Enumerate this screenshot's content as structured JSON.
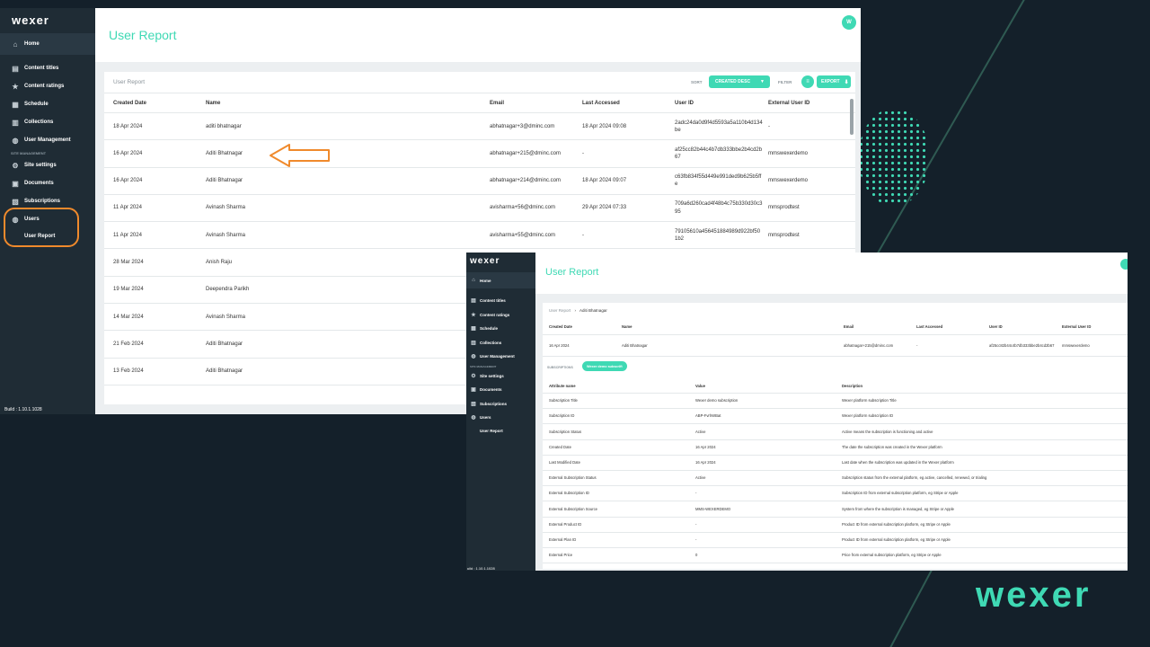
{
  "brand": "wexer",
  "sidebar": {
    "logo": "wexer",
    "home": "Home",
    "content_titles": "Content titles",
    "content_ratings": "Content ratings",
    "schedule": "Schedule",
    "collections": "Collections",
    "user_management": "User Management",
    "site_management_label": "SITE MANAGEMENT",
    "site_settings": "Site settings",
    "documents": "Documents",
    "subscriptions": "Subscriptions",
    "users": "Users",
    "user_report": "User Report",
    "build": "Build : 1.10.1.1028",
    "build_cut": "uild : 1.10.1.1028"
  },
  "report": {
    "page_title": "User Report",
    "avatar": "W",
    "card_title": "User Report",
    "sort_label": "SORT",
    "sort_value": "CREATED DESC",
    "filter_label": "FILTER",
    "export_label": "EXPORT",
    "columns": [
      "Created Date",
      "Name",
      "Email",
      "Last Accessed",
      "User ID",
      "External User ID"
    ],
    "rows": [
      [
        "18 Apr 2024",
        "aditi bhatnagar",
        "abhatnagar+3@dminc.com",
        "18 Apr 2024 09:08",
        "2adc24da0d9f4d5593a5a110b4d134be",
        "-"
      ],
      [
        "16 Apr 2024",
        "Aditi Bhatnagar",
        "abhatnagar+215@dminc.com",
        "-",
        "af25cc82b44c4b7db333bbe2b4cd2b67",
        "mmswexerdemo"
      ],
      [
        "16 Apr 2024",
        "Aditi Bhatnagar",
        "abhatnagar+214@dminc.com",
        "18 Apr 2024 09:07",
        "c63fb834f55d449e991ded9b625b5ffe",
        "mmswexerdemo"
      ],
      [
        "11 Apr 2024",
        "Avinash Sharma",
        "avisharma+56@dminc.com",
        "29 Apr 2024 07:33",
        "709a6d260cad4f48b4c75b330d30c395",
        "mmsprodtest"
      ],
      [
        "11 Apr 2024",
        "Avinash Sharma",
        "avisharma+55@dminc.com",
        "-",
        "79105610a456451884989d922bf501b2",
        "mmsprodtest"
      ],
      [
        "28 Mar 2024",
        "Anish Raju",
        "",
        "",
        "",
        ""
      ],
      [
        "19 Mar 2024",
        "Deependra Parikh",
        "",
        "",
        "",
        ""
      ],
      [
        "14 Mar 2024",
        "Avinash Sharma",
        "",
        "",
        "",
        ""
      ],
      [
        "21 Feb 2024",
        "Aditi Bhatnagar",
        "",
        "",
        "",
        ""
      ],
      [
        "13 Feb 2024",
        "Aditi Bhatnagar",
        "",
        "",
        "",
        ""
      ]
    ]
  },
  "detail": {
    "page_title": "User Report",
    "breadcrumb_root": "User Report",
    "breadcrumb_sep": "›",
    "breadcrumb_current": "Aditi Bhatnagar",
    "columns": [
      "Created Date",
      "Name",
      "Email",
      "Last Accessed",
      "User ID",
      "External User ID"
    ],
    "user_row": [
      "16 Apr 2024",
      "Aditi Bhatnagar",
      "abhatnagar+215@dminc.com",
      "-",
      "af25cc82b44c4b7db333bbe2b4cd2b67",
      "mmswexerdemo"
    ],
    "subscriptions_label": "SUBSCRIPTIONS",
    "subscription_chip": "Wexer demo subscrift",
    "attr_columns": [
      "Attribute name",
      "Value",
      "Description"
    ],
    "attributes": [
      [
        "Subscription Title",
        "Wexer demo subscription",
        "Wexer platform subscription Title"
      ],
      [
        "Subscription ID",
        "ABP-FvrhWBat",
        "Wexer platform subscription ID"
      ],
      [
        "Subscription Status",
        "Active",
        "Active means the subscription is functioning and active"
      ],
      [
        "Created Date",
        "16 Apr 2024",
        "The date the subscription was created in the Wexer platform"
      ],
      [
        "Last Modified Date",
        "16 Apr 2024",
        "Last date when the subscription was updated in the Wexer platform"
      ],
      [
        "External Subscription Status",
        "Active",
        "Subscription status from the external platform, eg active, cancelled, renewed, or trialing"
      ],
      [
        "External Subscription ID",
        "-",
        "Subscription ID from external subscription platform, eg Stripe or Apple"
      ],
      [
        "External Subscription Source",
        "MMS-WEXERDEMO",
        "System from where the subscription is managed, eg Stripe or Apple"
      ],
      [
        "External Product ID",
        "-",
        "Product ID from external subscription platform, eg Stripe or Apple"
      ],
      [
        "External Plan ID",
        "-",
        "Product ID from external subscription platform, eg Stripe or Apple"
      ],
      [
        "External Price",
        "0",
        "Price from external subscription platform, eg Stripe or Apple"
      ]
    ]
  },
  "colors": {
    "accent": "#3fd9b4",
    "sidebar": "#1f2c35",
    "highlight": "#f08a2c",
    "background": "#14202a"
  }
}
